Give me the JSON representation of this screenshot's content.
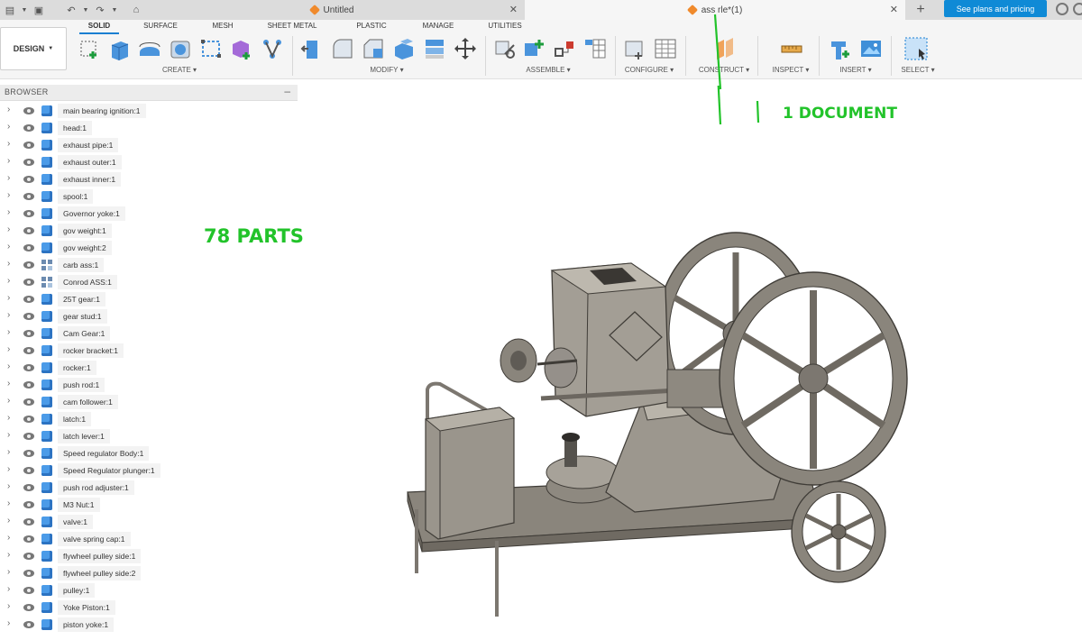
{
  "titlebar": {
    "tabs": [
      {
        "title": "Untitled"
      },
      {
        "title": "ass rle*(1)"
      }
    ],
    "plans_button": "See plans and pricing"
  },
  "toolbar": {
    "design_label": "DESIGN",
    "workspace_tabs": [
      "SOLID",
      "SURFACE",
      "MESH",
      "SHEET METAL",
      "PLASTIC",
      "MANAGE",
      "UTILITIES"
    ],
    "groups": [
      "CREATE ▾",
      "MODIFY ▾",
      "ASSEMBLE ▾",
      "CONFIGURE ▾",
      "CONSTRUCT ▾",
      "INSPECT ▾",
      "INSERT ▾",
      "SELECT ▾"
    ]
  },
  "browser": {
    "title": "BROWSER",
    "items": [
      {
        "label": "main bearing ignition:1",
        "type": "component"
      },
      {
        "label": "head:1",
        "type": "component"
      },
      {
        "label": "exhaust pipe:1",
        "type": "component"
      },
      {
        "label": "exhaust outer:1",
        "type": "component"
      },
      {
        "label": "exhaust inner:1",
        "type": "component"
      },
      {
        "label": "spool:1",
        "type": "component"
      },
      {
        "label": "Governor yoke:1",
        "type": "component"
      },
      {
        "label": "gov weight:1",
        "type": "component"
      },
      {
        "label": "gov weight:2",
        "type": "component"
      },
      {
        "label": "carb ass:1",
        "type": "assembly"
      },
      {
        "label": "Conrod ASS:1",
        "type": "assembly"
      },
      {
        "label": "25T gear:1",
        "type": "component"
      },
      {
        "label": "gear stud:1",
        "type": "component"
      },
      {
        "label": "Cam Gear:1",
        "type": "component"
      },
      {
        "label": "rocker bracket:1",
        "type": "component"
      },
      {
        "label": "rocker:1",
        "type": "component"
      },
      {
        "label": "push rod:1",
        "type": "component"
      },
      {
        "label": "cam follower:1",
        "type": "component"
      },
      {
        "label": "latch:1",
        "type": "component"
      },
      {
        "label": "latch lever:1",
        "type": "component"
      },
      {
        "label": "Speed regulator Body:1",
        "type": "component"
      },
      {
        "label": "Speed Regulator plunger:1",
        "type": "component"
      },
      {
        "label": "push rod adjuster:1",
        "type": "component"
      },
      {
        "label": "M3 Nut:1",
        "type": "component"
      },
      {
        "label": "valve:1",
        "type": "component"
      },
      {
        "label": "valve spring cap:1",
        "type": "component"
      },
      {
        "label": "flywheel pulley side:1",
        "type": "component"
      },
      {
        "label": "flywheel pulley side:2",
        "type": "component"
      },
      {
        "label": "pulley:1",
        "type": "component"
      },
      {
        "label": "Yoke Piston:1",
        "type": "component"
      },
      {
        "label": "piston yoke:1",
        "type": "component"
      }
    ]
  },
  "annotations": {
    "parts_note": "78 PARTS",
    "document_note": "1 DOCUMENT"
  },
  "colors": {
    "accent": "#0f8ad6",
    "annotation": "#22c32a",
    "tab_icon": "#f08a2c",
    "component_icon": "#4b9be8"
  }
}
